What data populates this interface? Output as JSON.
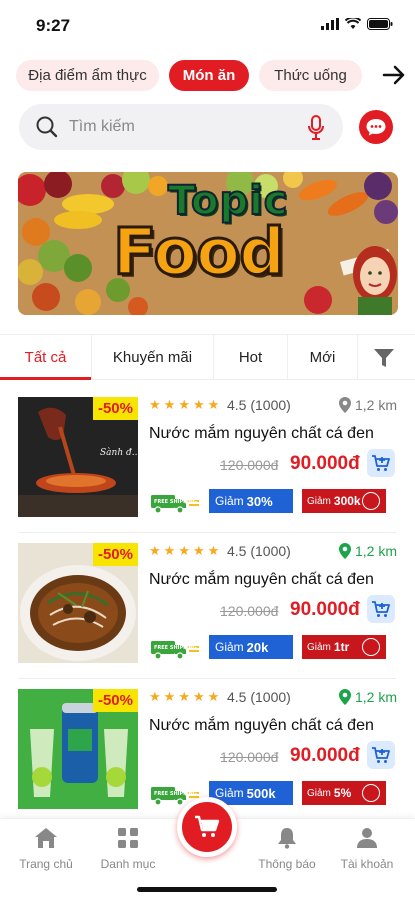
{
  "status_bar": {
    "time": "9:27"
  },
  "categories": {
    "items": [
      "Địa điểm ẩm thực",
      "Món ăn",
      "Thức uống"
    ],
    "active_index": 1
  },
  "search": {
    "placeholder": "Tìm kiếm"
  },
  "banner": {
    "title_top": "Topic",
    "title_bottom": "Food"
  },
  "tabs": {
    "items": [
      "Tất cả",
      "Khuyến mãi",
      "Hot",
      "Mới"
    ],
    "active_index": 0
  },
  "products": [
    {
      "discount": "-50%",
      "rating_text": "4.5 (1000)",
      "stars": 5,
      "distance": "1,2 km",
      "distance_color": "gray",
      "name": "Nước mắm nguyên chất cá đen",
      "old_price": "120.000đ",
      "new_price": "90.000đ",
      "coupon_blue_label": "Giảm",
      "coupon_blue_value": "30%",
      "coupon_red_label": "Giảm",
      "coupon_red_value": "300k"
    },
    {
      "discount": "-50%",
      "rating_text": "4.5 (1000)",
      "stars": 5,
      "distance": "1,2 km",
      "distance_color": "green",
      "name": "Nước mắm nguyên chất cá đen",
      "old_price": "120.000đ",
      "new_price": "90.000đ",
      "coupon_blue_label": "Giảm",
      "coupon_blue_value": "20k",
      "coupon_red_label": "Giảm",
      "coupon_red_value": "1tr"
    },
    {
      "discount": "-50%",
      "rating_text": "4.5 (1000)",
      "stars": 5,
      "distance": "1,2 km",
      "distance_color": "green",
      "name": "Nước mắm nguyên chất cá đen",
      "old_price": "120.000đ",
      "new_price": "90.000đ",
      "coupon_blue_label": "Giảm",
      "coupon_blue_value": "500k",
      "coupon_red_label": "Giảm",
      "coupon_red_value": "5%"
    }
  ],
  "free_ship_label": "FREE SHIPPING",
  "bottom_nav": {
    "items": [
      "Trang chủ",
      "Danh mục",
      "Thông báo",
      "Tài khoản"
    ]
  },
  "colors": {
    "primary": "#e21c23",
    "coupon_blue": "#1e62d6",
    "green": "#1ca34b",
    "star": "#f7a81b"
  }
}
